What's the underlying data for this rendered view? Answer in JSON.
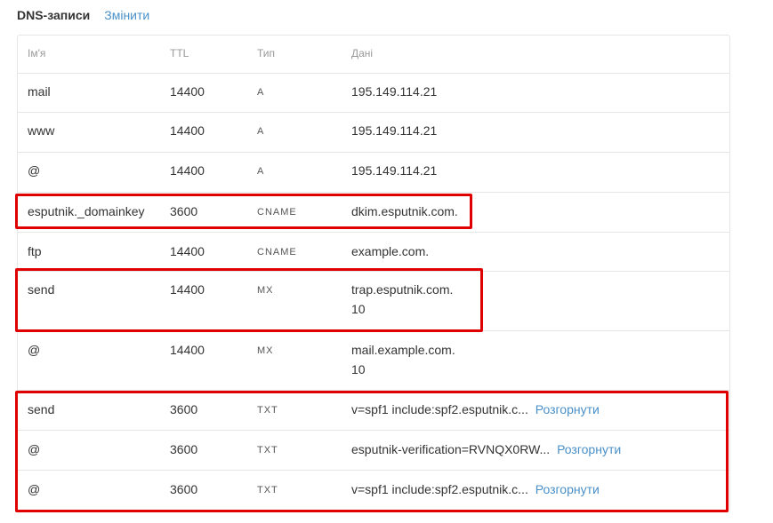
{
  "header": {
    "title": "DNS-записи",
    "edit_label": "Змінити"
  },
  "table": {
    "columns": [
      "Ім'я",
      "TTL",
      "Тип",
      "Дані"
    ],
    "rows": [
      {
        "name": "mail",
        "ttl": "14400",
        "type": "A",
        "data": "195.149.114.21",
        "data2": "",
        "expand": ""
      },
      {
        "name": "www",
        "ttl": "14400",
        "type": "A",
        "data": "195.149.114.21",
        "data2": "",
        "expand": ""
      },
      {
        "name": "@",
        "ttl": "14400",
        "type": "A",
        "data": "195.149.114.21",
        "data2": "",
        "expand": ""
      },
      {
        "name": "esputnik._domainkey",
        "ttl": "3600",
        "type": "CNAME",
        "data": "dkim.esputnik.com.",
        "data2": "",
        "expand": ""
      },
      {
        "name": "ftp",
        "ttl": "14400",
        "type": "CNAME",
        "data": "example.com.",
        "data2": "",
        "expand": ""
      },
      {
        "name": "send",
        "ttl": "14400",
        "type": "MX",
        "data": "trap.esputnik.com.",
        "data2": "10",
        "expand": ""
      },
      {
        "name": "@",
        "ttl": "14400",
        "type": "MX",
        "data": "mail.example.com.",
        "data2": "10",
        "expand": ""
      },
      {
        "name": "send",
        "ttl": "3600",
        "type": "TXT",
        "data": "v=spf1 include:spf2.esputnik.c...",
        "data2": "",
        "expand": "Розгорнути"
      },
      {
        "name": "@",
        "ttl": "3600",
        "type": "TXT",
        "data": "esputnik-verification=RVNQX0RW...",
        "data2": "",
        "expand": "Розгорнути"
      },
      {
        "name": "@",
        "ttl": "3600",
        "type": "TXT",
        "data": "v=spf1 include:spf2.esputnik.c...",
        "data2": "",
        "expand": "Розгорнути"
      }
    ]
  },
  "colors": {
    "link": "#4a90c8",
    "highlight": "#e00000",
    "border": "#e6e6e6"
  }
}
